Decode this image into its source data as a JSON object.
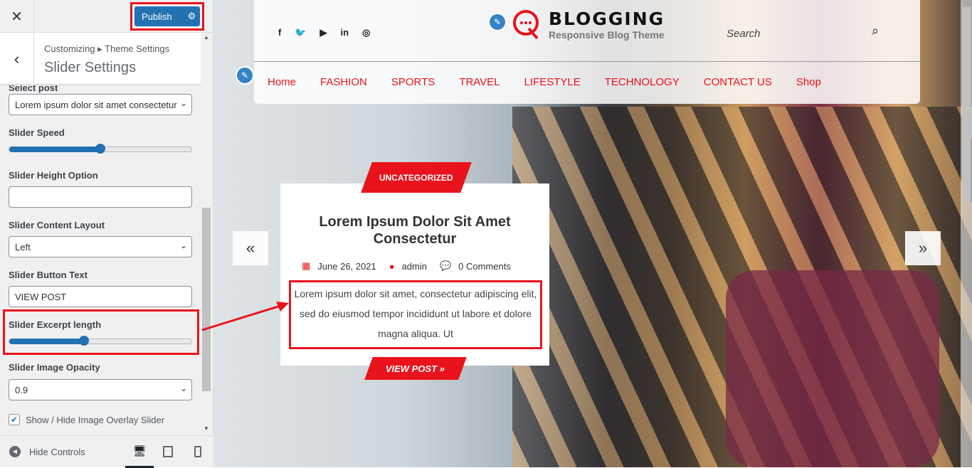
{
  "sidebar": {
    "close_icon": "close-icon",
    "publish_label": "Publish",
    "breadcrumb": "Customizing ▸ Theme Settings",
    "section_title": "Slider Settings",
    "select_post_label": "Select post",
    "select_post_value": "Lorem ipsum dolor sit amet consectetur",
    "slider_speed_label": "Slider Speed",
    "slider_speed_percent": 50,
    "height_label": "Slider Height Option",
    "height_value": "",
    "layout_label": "Slider Content Layout",
    "layout_value": "Left",
    "button_text_label": "Slider Button Text",
    "button_text_value": "VIEW POST",
    "excerpt_label": "Slider Excerpt length",
    "excerpt_percent": 41,
    "opacity_label": "Slider Image Opacity",
    "opacity_value": "0.9",
    "overlay_label": "Show / Hide Image Overlay Slider",
    "overlay_checked": true,
    "hide_controls": "Hide Controls"
  },
  "site": {
    "title": "BLOGGING",
    "tagline": "Responsive Blog Theme",
    "search_placeholder": "Search",
    "social": [
      "f",
      "🐦",
      "▶",
      "in",
      "◎"
    ],
    "nav": [
      "Home",
      "FASHION",
      "SPORTS",
      "TRAVEL",
      "LIFESTYLE",
      "TECHNOLOGY",
      "CONTACT US",
      "Shop"
    ]
  },
  "slide": {
    "category": "UNCATEGORIZED",
    "title": "Lorem Ipsum Dolor Sit Amet Consectetur",
    "date": "June 26, 2021",
    "author": "admin",
    "comments": "0 Comments",
    "excerpt": "Lorem ipsum dolor sit amet, consectetur adipiscing elit, sed do eiusmod tempor incididunt ut labore et dolore magna aliqua. Ut",
    "button": "VIEW POST »",
    "prev": "«",
    "next": "»"
  },
  "colors": {
    "accent": "#e8131c",
    "wp_blue": "#2271b1"
  }
}
